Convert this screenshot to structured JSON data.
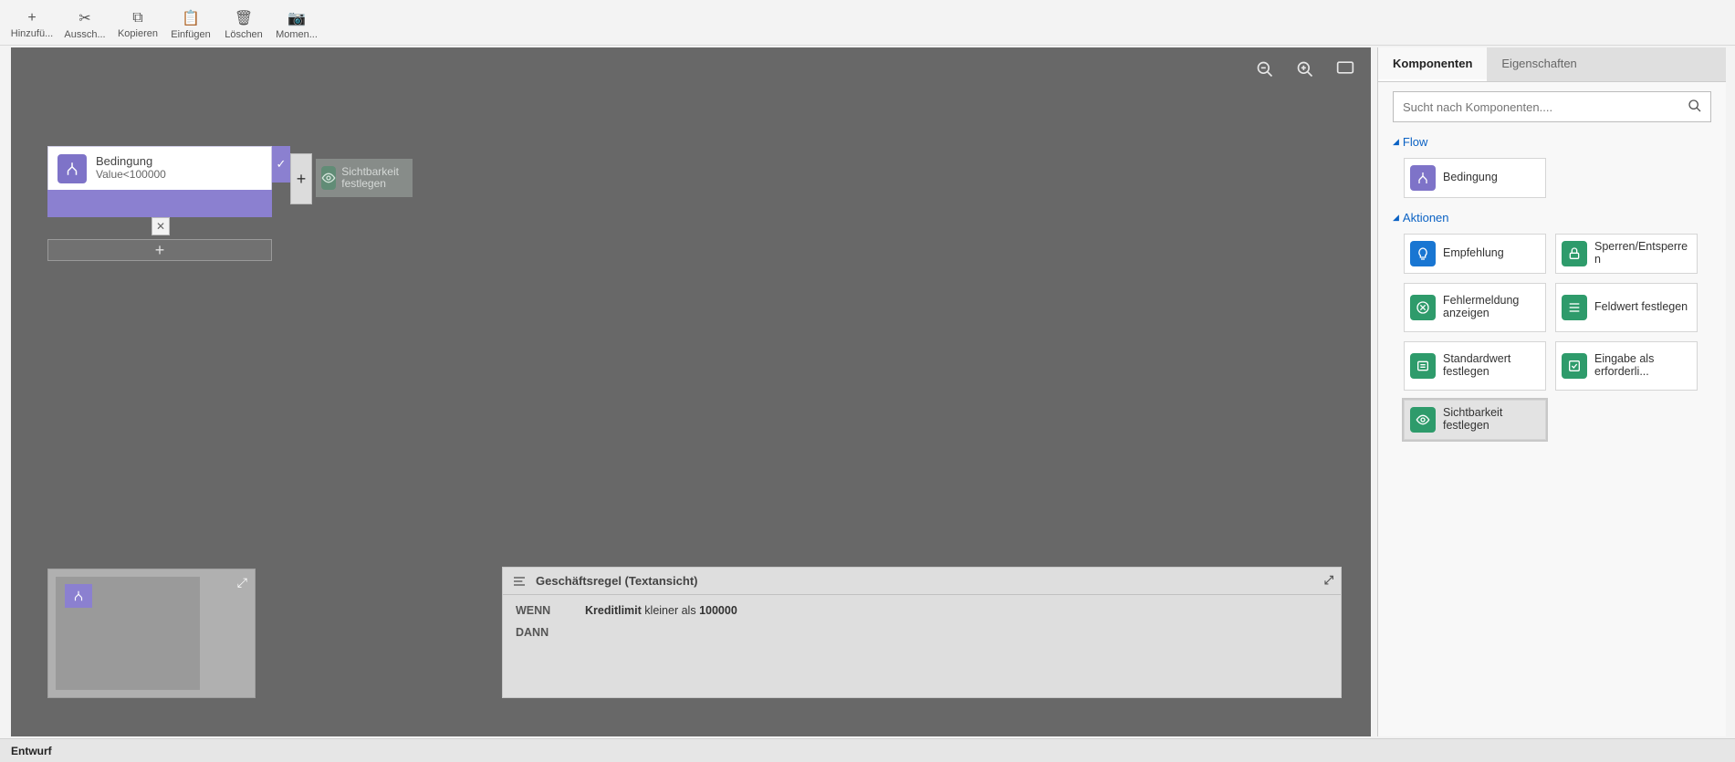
{
  "toolbar": {
    "add": "Hinzufü...",
    "cut": "Aussch...",
    "copy": "Kopieren",
    "paste": "Einfügen",
    "delete": "Löschen",
    "snapshot": "Momen..."
  },
  "canvas": {
    "condition_title": "Bedingung",
    "condition_expr": "Value<100000",
    "action_label": "Sichtbarkeit festlegen"
  },
  "textview": {
    "title": "Geschäftsregel (Textansicht)",
    "when": "WENN",
    "then": "DANN",
    "field": "Kreditlimit",
    "op": "kleiner als",
    "value": "100000"
  },
  "side": {
    "tab_components": "Komponenten",
    "tab_properties": "Eigenschaften",
    "search_placeholder": "Sucht nach Komponenten....",
    "sect_flow": "Flow",
    "flow_item": "Bedingung",
    "sect_actions": "Aktionen",
    "actions": {
      "recommend": "Empfehlung",
      "lock": "Sperren/Entsperren",
      "error": "Fehlermeldung anzeigen",
      "setvalue": "Feldwert festlegen",
      "default": "Standardwert festlegen",
      "required": "Eingabe als erforderli...",
      "visibility": "Sichtbarkeit festlegen"
    }
  },
  "status": "Entwurf"
}
